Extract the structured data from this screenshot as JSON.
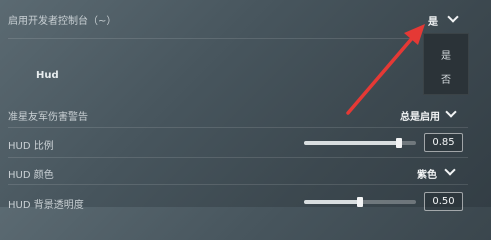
{
  "settings": {
    "dev_console": {
      "label": "启用开发者控制台（~）",
      "value": "是"
    },
    "dropdown_options": [
      "是",
      "否"
    ],
    "section_hud": "Hud",
    "friendly_fire_warning": {
      "label": "准星友军伤害警告",
      "value": "总是启用"
    },
    "hud_scale": {
      "label": "HUD 比例",
      "value": "0.85",
      "level": 0.85
    },
    "hud_color": {
      "label": "HUD 颜色",
      "value": "紫色"
    },
    "hud_bg_opacity": {
      "label": "HUD 背景透明度",
      "value": "0.50",
      "level": 0.5
    }
  },
  "colors": {
    "accent_arrow": "#e53935"
  },
  "icons": {
    "dropdown": "chevron-down-icon"
  }
}
